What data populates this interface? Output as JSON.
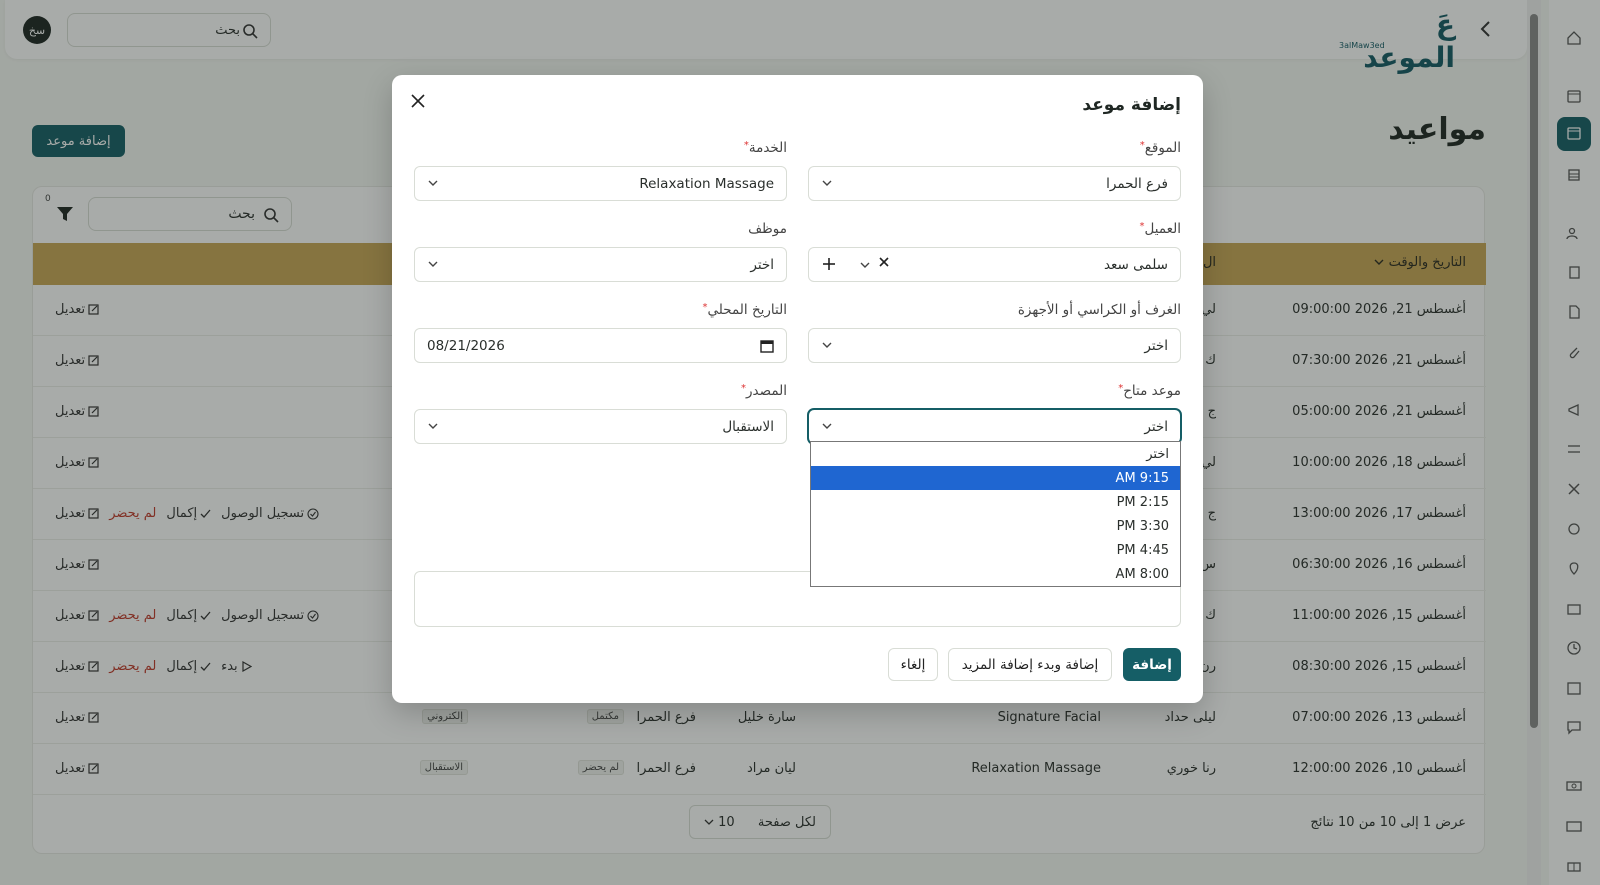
{
  "topbar": {
    "avatar": "سخ",
    "search_placeholder": "بحث",
    "logo_word": "عَ الموعد",
    "logo_sub": "3alMaw3ed"
  },
  "page": {
    "title": "مواعيد",
    "add_button": "إضافة موعد"
  },
  "table": {
    "filter_count": "0",
    "search_placeholder": "بحث",
    "headers": {
      "datetime": "التاريخ والوقت",
      "client_partial": "ال"
    },
    "rows": [
      {
        "datetime": "أغسطس 21, 2026 09:00:00",
        "client": "لي",
        "service": "",
        "staff": "",
        "location": "",
        "status": "",
        "source": "",
        "actions": [
          "edit"
        ]
      },
      {
        "datetime": "أغسطس 21, 2026 07:30:00",
        "client": "ك",
        "actions": [
          "edit"
        ]
      },
      {
        "datetime": "أغسطس 21, 2026 05:00:00",
        "client": "ج",
        "actions": [
          "edit"
        ]
      },
      {
        "datetime": "أغسطس 18, 2026 10:00:00",
        "client": "لي",
        "actions": [
          "edit"
        ]
      },
      {
        "datetime": "أغسطس 17, 2026 13:00:00",
        "client": "ج",
        "actions": [
          "checkin",
          "complete",
          "noshow",
          "edit"
        ]
      },
      {
        "datetime": "أغسطس 16, 2026 06:30:00",
        "client": "س",
        "actions": [
          "edit"
        ]
      },
      {
        "datetime": "أغسطس 15, 2026 11:00:00",
        "client": "ك",
        "actions": [
          "checkin",
          "complete",
          "noshow",
          "edit"
        ]
      },
      {
        "datetime": "أغسطس 15, 2026 08:30:00",
        "client": "رن",
        "actions": [
          "start",
          "complete",
          "noshow",
          "edit"
        ]
      },
      {
        "datetime": "أغسطس 13, 2026 07:00:00",
        "client": "ليلى حداد",
        "service": "Signature Facial",
        "staff": "سارة خليل",
        "location": "فرع الحمرا",
        "status": "مكتمل",
        "source": "إلكتروني",
        "actions": [
          "edit"
        ]
      },
      {
        "datetime": "أغسطس 10, 2026 12:00:00",
        "client": "رنا خوري",
        "service": "Relaxation Massage",
        "staff": "ليان مراد",
        "location": "فرع الحمرا",
        "status": "لم يحضر",
        "source": "الاستقبال",
        "actions": [
          "edit"
        ]
      }
    ],
    "action_labels": {
      "edit": "تعديل",
      "checkin": "تسجيل الوصول",
      "complete": "إكمال",
      "noshow": "لم يحضر",
      "start": "بدء"
    },
    "footer": {
      "info": "عرض 1 إلى 10 من 10 نتائج",
      "per_page_label": "لكل صفحة",
      "per_page_value": "10"
    }
  },
  "modal": {
    "title": "إضافة موعد",
    "fields": {
      "location": {
        "label": "الموقع",
        "value": "فرع الحمرا"
      },
      "service": {
        "label": "الخدمة",
        "value": "Relaxation Massage"
      },
      "client": {
        "label": "العميل",
        "value": "سلمى سعد"
      },
      "staff": {
        "label": "موظف",
        "value": "اختر"
      },
      "rooms": {
        "label": "الغرف أو الكراسي أو الأجهزة",
        "value": "اختر"
      },
      "date": {
        "label": "التاريخ المحلي",
        "value": "08/21/2026"
      },
      "slot": {
        "label": "موعد متاح",
        "value": "اختر"
      },
      "source": {
        "label": "المصدر",
        "value": "الاستقبال"
      }
    },
    "slot_options": [
      "اختر",
      "9:15 AM",
      "2:15 PM",
      "3:30 PM",
      "4:45 PM",
      "8:00 AM"
    ],
    "slot_selected_index": 1,
    "buttons": {
      "add": "إضافة",
      "add_more": "إضافة وبدء إضافة المزيد",
      "cancel": "إلغاء"
    }
  }
}
